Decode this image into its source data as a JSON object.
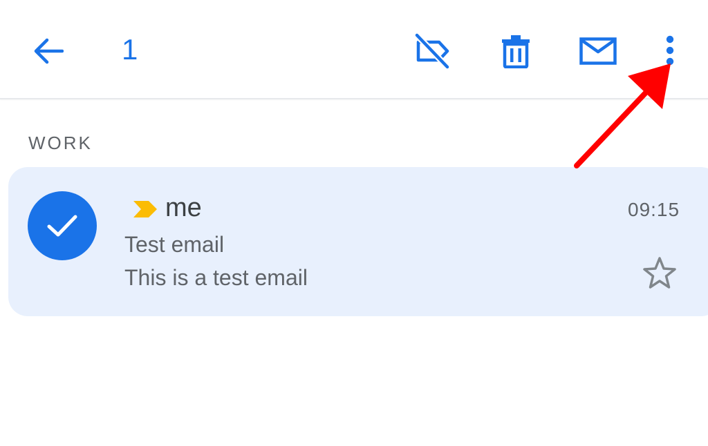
{
  "toolbar": {
    "back_icon": "arrow-left-icon",
    "selected_count": "1",
    "label_icon": "label-off-icon",
    "delete_icon": "trash-icon",
    "mail_icon": "mail-icon",
    "more_icon": "more-vertical-icon",
    "accent_color": "#1a73e8"
  },
  "section": {
    "label": "WORK"
  },
  "email": {
    "sender": "me",
    "time": "09:15",
    "subject": "Test email",
    "snippet": "This is a test email",
    "selected": true,
    "importance_marker_color": "#fbbc04",
    "starred": false,
    "row_background": "#e8f0fd"
  },
  "annotation": {
    "type": "arrow",
    "color": "#ff0000",
    "points_to": "more-options-button"
  }
}
